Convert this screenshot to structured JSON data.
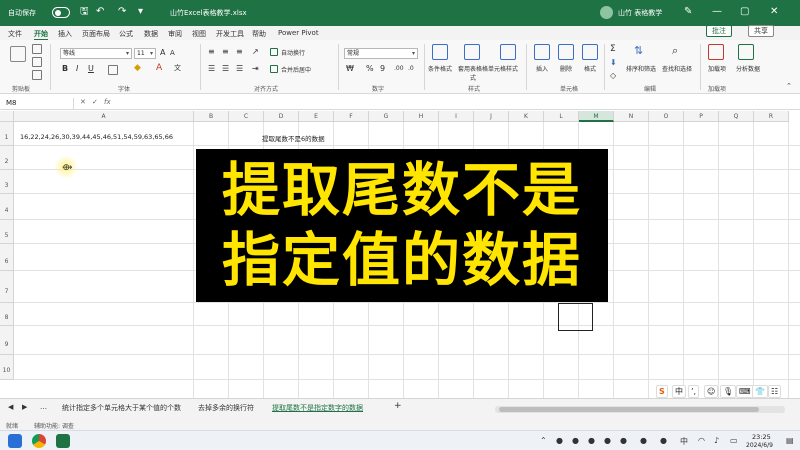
{
  "titlebar": {
    "autosave_label": "自动保存",
    "file_name": "山竹Excel表格教学.xlsx",
    "user_name": "山竹 表格教学",
    "comments_label": "批注",
    "share_label": "共享"
  },
  "menu": [
    "文件",
    "开始",
    "插入",
    "页面布局",
    "公式",
    "数据",
    "审阅",
    "视图",
    "开发工具",
    "帮助",
    "Power Pivot"
  ],
  "menu_active": "开始",
  "ribbon": {
    "font_name": "等线",
    "font_size": "11",
    "wrap_text": "自动换行",
    "merge_center": "合并后居中",
    "number_format": "常规",
    "cond_format": "条件格式",
    "table_format": "套用表格格式",
    "cell_style": "单元格样式",
    "insert": "插入",
    "delete": "删除",
    "format": "格式",
    "sort_filter": "排序和筛选",
    "find_select": "查找和选择",
    "add_in": "加载项",
    "analyze": "分析数据",
    "groups": {
      "clipboard": "剪贴板",
      "font": "字体",
      "alignment": "对齐方式",
      "number": "数字",
      "styles": "样式",
      "cells": "单元格",
      "editing": "编辑",
      "addins": "加载项"
    }
  },
  "formula_bar": {
    "name_box": "M8",
    "fx": "fx"
  },
  "grid": {
    "columns": [
      "A",
      "B",
      "C",
      "D",
      "E",
      "F",
      "G",
      "H",
      "I",
      "J",
      "K",
      "L",
      "M",
      "N",
      "O",
      "P",
      "Q",
      "R"
    ],
    "selected_column": "M",
    "rows": [
      "1",
      "2",
      "3",
      "4",
      "5",
      "6",
      "7",
      "8",
      "9",
      "10"
    ],
    "cell_a1": "16,22,24,26,30,39,44,45,46,51,54,59,63,65,66",
    "cell_d1": "提取尾数不是6的数据"
  },
  "overlay": {
    "line1": "提取尾数不是",
    "line2": "指定值的数据"
  },
  "sheet_tabs": [
    "统计指定多个单元格大于某个值的个数",
    "去掉多余的换行符",
    "提取尾数不是指定数字的数据"
  ],
  "sheet_active_index": 2,
  "add_sheet": "+",
  "status": {
    "ready": "就绪",
    "accessibility": "辅助功能: 调查"
  },
  "ime": [
    "S",
    "中",
    "ʼ,"
  ],
  "taskbar": {
    "time": "23:25",
    "date": "2024/6/9"
  },
  "colors": {
    "excel_green": "#1f7244",
    "overlay_text": "#ffe500",
    "overlay_bg": "#000000"
  }
}
